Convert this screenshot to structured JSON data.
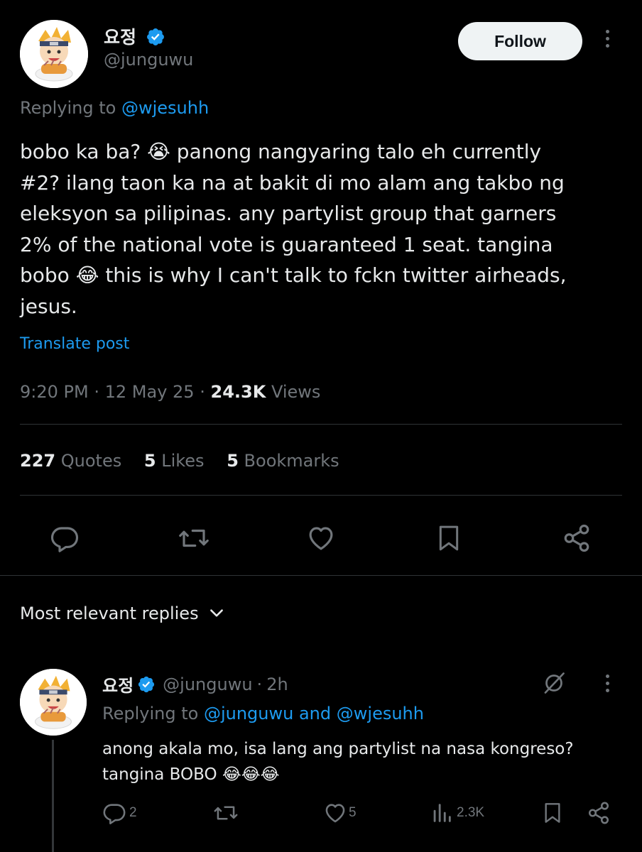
{
  "tweet": {
    "author_name": "요정",
    "author_handle": "@junguwu",
    "follow_label": "Follow",
    "replying_prefix": "Replying to",
    "replying_to": "@wjesuhh",
    "text_lines": [
      "bobo ka ba? 😭 panong nangyaring talo eh currently",
      "#2? ilang taon ka na at bakit di mo alam ang takbo ng",
      "eleksyon sa pilipinas. any partylist group that garners",
      "2% of the national vote is guaranteed 1 seat. tangina",
      "bobo 😂 this is why I can't talk to fckn twitter airheads,",
      "jesus."
    ],
    "translate_label": "Translate post",
    "time": "9:20 PM",
    "date": "12 May 25",
    "views_count": "24.3K",
    "views_label": "Views",
    "sep": "·",
    "quotes_count": "227",
    "quotes_label": "Quotes",
    "likes_count": "5",
    "likes_label": "Likes",
    "bookmarks_count": "5",
    "bookmarks_label": "Bookmarks"
  },
  "replies_header": {
    "label": "Most relevant replies"
  },
  "reply": {
    "author_name": "요정",
    "author_handle": "@junguwu",
    "time_ago": "2h",
    "sep": "·",
    "replying_prefix": "Replying to",
    "replying_to_1": "@junguwu",
    "and_label": "and",
    "replying_to_2": "@wjesuhh",
    "text_lines": [
      "anong akala mo, isa lang ang partylist na nasa kongreso?",
      "tangina BOBO 😂😂😂"
    ],
    "reply_count": "2",
    "like_count": "5",
    "views_count": "2.3K"
  },
  "colors": {
    "background": "#000000",
    "text": "#e7e9ea",
    "muted": "#71767b",
    "link": "#1d9bf0",
    "verified": "#1d9bf0",
    "follow_bg": "#eff3f4"
  }
}
